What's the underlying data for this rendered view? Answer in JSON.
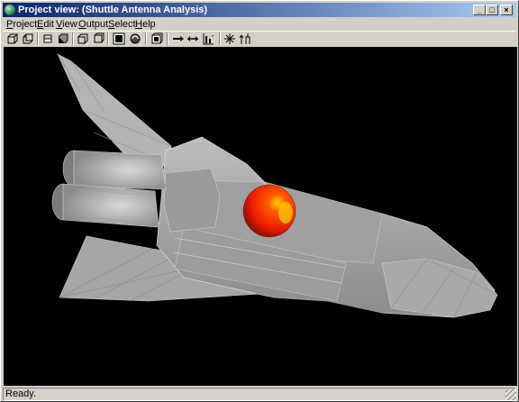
{
  "window": {
    "title": "Project view: (Shuttle Antenna Analysis)"
  },
  "title_buttons": {
    "minimize": "_",
    "maximize": "□",
    "close": "×"
  },
  "menu": [
    {
      "label": "Project"
    },
    {
      "label": "Edit"
    },
    {
      "label": "View"
    },
    {
      "label": "Output"
    },
    {
      "label": "Select"
    },
    {
      "label": "Help"
    }
  ],
  "toolbar": {
    "icons": [
      "view-front-icon",
      "view-back-icon",
      "view-left-icon",
      "view-right-icon",
      "view-top-icon",
      "view-bottom-icon",
      "render-icon",
      "rotate-icon",
      "perspective-icon",
      "arrow-right-icon",
      "arrow-double-icon",
      "graph-icon",
      "star-icon",
      "axis-icon"
    ]
  },
  "status": {
    "text": "Ready."
  },
  "colors": {
    "titlebar_start": "#0a246a",
    "titlebar_end": "#a6caf0",
    "viewport_bg": "#000000",
    "shuttle_gray": "#a8a8a8",
    "pattern_red": "#ff2a00"
  }
}
